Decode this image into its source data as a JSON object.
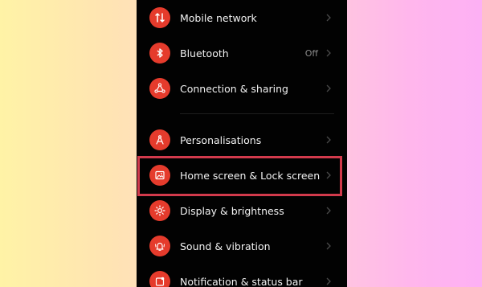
{
  "settings": {
    "items": [
      {
        "label": "Mobile network",
        "icon": "mobile-network-icon"
      },
      {
        "label": "Bluetooth",
        "value": "Off",
        "icon": "bluetooth-icon"
      },
      {
        "label": "Connection & sharing",
        "icon": "connection-sharing-icon"
      },
      {
        "label": "Personalisations",
        "icon": "personalisation-icon"
      },
      {
        "label": "Home screen & Lock screen",
        "icon": "image-icon"
      },
      {
        "label": "Display & brightness",
        "icon": "sun-icon"
      },
      {
        "label": "Sound & vibration",
        "icon": "bell-icon"
      },
      {
        "label": "Notification & status bar",
        "icon": "notification-icon"
      }
    ]
  },
  "colors": {
    "icon_background": "#e53b2c",
    "highlight_border": "#d23a4c",
    "screen_background": "#020202"
  }
}
